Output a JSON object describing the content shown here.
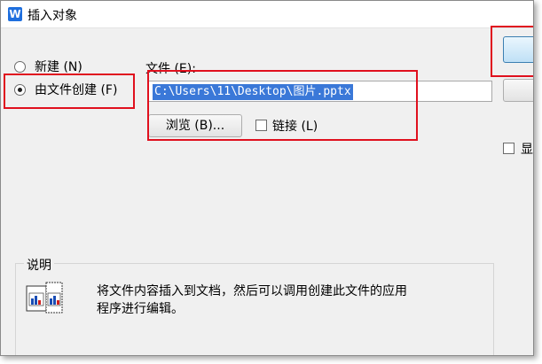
{
  "window": {
    "title": "插入对象",
    "app_icon": "W"
  },
  "options": {
    "new_label": "新建 (N)",
    "from_file_label": "由文件创建 (F)",
    "selected": "from_file"
  },
  "file": {
    "label": "文件 (E):",
    "path": "C:\\Users\\11\\Desktop\\图片.pptx"
  },
  "buttons": {
    "browse_label": "浏览 (B)...",
    "ok_label": "",
    "cancel_label": ""
  },
  "link": {
    "label": "链接 (L)",
    "checked": false
  },
  "display_as_icon": {
    "label": "显",
    "checked": false
  },
  "description": {
    "title": "说明",
    "text_line1": "将文件内容插入到文档，然后可以调用创建此文件的应用",
    "text_line2": "程序进行编辑。"
  },
  "colors": {
    "highlight": "#e0101e",
    "selection": "#3a78d8"
  }
}
